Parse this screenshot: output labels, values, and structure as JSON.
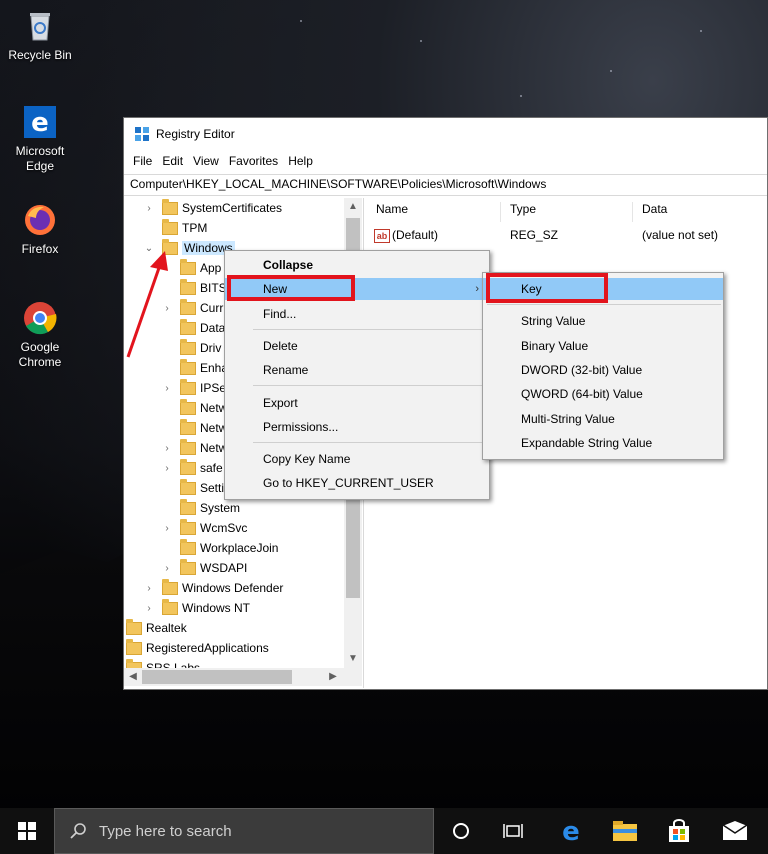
{
  "desktop": {
    "icons": [
      {
        "label": "Recycle Bin"
      },
      {
        "label": "Microsoft\nEdge"
      },
      {
        "label": "Firefox"
      },
      {
        "label": "Google\nChrome"
      }
    ]
  },
  "window": {
    "title": "Registry Editor",
    "menu": [
      "File",
      "Edit",
      "View",
      "Favorites",
      "Help"
    ],
    "address": "Computer\\HKEY_LOCAL_MACHINE\\SOFTWARE\\Policies\\Microsoft\\Windows"
  },
  "tree": [
    {
      "label": "SystemCertificates",
      "exp": ">"
    },
    {
      "label": "TPM",
      "exp": ""
    },
    {
      "label": "Windows",
      "exp": "v"
    },
    {
      "label": "App",
      "exp": ""
    },
    {
      "label": "BITS",
      "exp": ""
    },
    {
      "label": "Curr",
      "exp": ">"
    },
    {
      "label": "Data",
      "exp": ""
    },
    {
      "label": "Driv",
      "exp": ""
    },
    {
      "label": "Enha",
      "exp": ""
    },
    {
      "label": "IPSe",
      "exp": ">"
    },
    {
      "label": "Netw",
      "exp": ""
    },
    {
      "label": "Netw",
      "exp": ""
    },
    {
      "label": "Netw",
      "exp": ">"
    },
    {
      "label": "safe",
      "exp": ">"
    },
    {
      "label": "Setti",
      "exp": ""
    },
    {
      "label": "System",
      "exp": ""
    },
    {
      "label": "WcmSvc",
      "exp": ">"
    },
    {
      "label": "WorkplaceJoin",
      "exp": ""
    },
    {
      "label": "WSDAPI",
      "exp": ">"
    },
    {
      "label": "Windows Defender",
      "exp": ">"
    },
    {
      "label": "Windows NT",
      "exp": ">"
    },
    {
      "label": "Realtek",
      "exp": ""
    },
    {
      "label": "RegisteredApplications",
      "exp": ""
    },
    {
      "label": "SRS Labs",
      "exp": ""
    }
  ],
  "list": {
    "headers": {
      "name": "Name",
      "type": "Type",
      "data": "Data"
    },
    "rows": [
      {
        "name": "(Default)",
        "type": "REG_SZ",
        "data": "(value not set)"
      }
    ]
  },
  "context_menu": {
    "items": [
      "Collapse",
      "New",
      "Find...",
      "Delete",
      "Rename",
      "Export",
      "Permissions...",
      "Copy Key Name",
      "Go to HKEY_CURRENT_USER"
    ]
  },
  "submenu": {
    "items": [
      "Key",
      "String Value",
      "Binary Value",
      "DWORD (32-bit) Value",
      "QWORD (64-bit) Value",
      "Multi-String Value",
      "Expandable String Value"
    ]
  },
  "taskbar": {
    "search_placeholder": "Type here to search"
  },
  "colors": {
    "highlight": "#91c9f7",
    "annotation_red": "#e2141d",
    "taskbar": "#101010"
  }
}
